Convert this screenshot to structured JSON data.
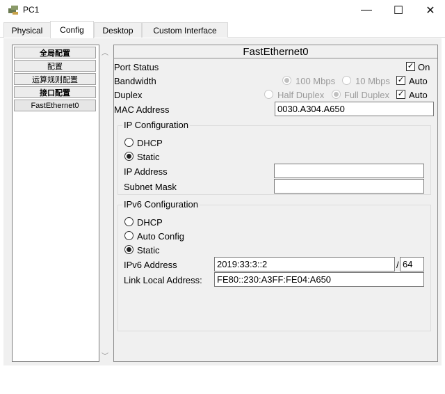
{
  "window": {
    "title": "PC1",
    "minimize_glyph": "—",
    "maximize_glyph": "☐",
    "close_glyph": "✕"
  },
  "tabs": [
    {
      "label": "Physical"
    },
    {
      "label": "Config"
    },
    {
      "label": "Desktop"
    },
    {
      "label": "Custom Interface"
    }
  ],
  "tree": {
    "items": [
      {
        "label": "全局配置"
      },
      {
        "label": "配置"
      },
      {
        "label": "运算规则配置"
      },
      {
        "label": "接口配置"
      },
      {
        "label": "FastEthernet0"
      }
    ],
    "scroll_up": "︿",
    "scroll_down": "﹀"
  },
  "panel": {
    "title": "FastEthernet0",
    "port_status": {
      "label": "Port Status",
      "on_label": "On",
      "checked": "☑"
    },
    "bandwidth": {
      "label": "Bandwidth",
      "option_100": "100 Mbps",
      "option_10": "10 Mbps",
      "auto_label": "Auto"
    },
    "duplex": {
      "label": "Duplex",
      "half": "Half Duplex",
      "full": "Full Duplex",
      "auto_label": "Auto"
    },
    "mac": {
      "label": "MAC Address",
      "value": "0030.A304.A650"
    },
    "ip_config": {
      "title": "IP Configuration",
      "dhcp": "DHCP",
      "static": "Static",
      "ip_label": "IP Address",
      "ip_value": "",
      "mask_label": "Subnet Mask",
      "mask_value": ""
    },
    "ipv6_config": {
      "title": "IPv6 Configuration",
      "dhcp": "DHCP",
      "auto_config": "Auto Config",
      "static": "Static",
      "addr_label": "IPv6 Address",
      "addr_value": "2019:33:3::2",
      "slash": "/",
      "prefix_value": "64",
      "link_local_label": "Link Local Address:",
      "link_local_value": "FE80::230:A3FF:FE04:A650"
    },
    "check_glyph": "✓"
  }
}
